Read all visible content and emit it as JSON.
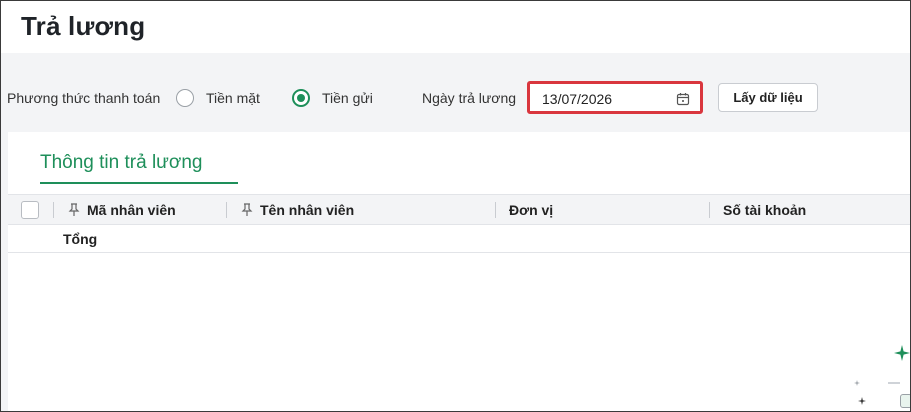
{
  "page": {
    "title": "Trả lương"
  },
  "payment": {
    "method_label": "Phương thức thanh toán",
    "options": [
      {
        "label": "Tiền mặt",
        "selected": false
      },
      {
        "label": "Tiền gửi",
        "selected": true
      }
    ],
    "date_label": "Ngày trả lương",
    "date_value": "13/07/2026",
    "fetch_button": "Lấy dữ liệu"
  },
  "tabs": [
    {
      "label": "Thông tin trả lương",
      "active": true
    }
  ],
  "table": {
    "columns": [
      "Mã nhân viên",
      "Tên nhân viên",
      "Đơn vị",
      "Số tài khoản"
    ],
    "total_label": "Tổng"
  },
  "colors": {
    "accent": "#1e8f5a",
    "highlight_border": "#d9363e"
  }
}
